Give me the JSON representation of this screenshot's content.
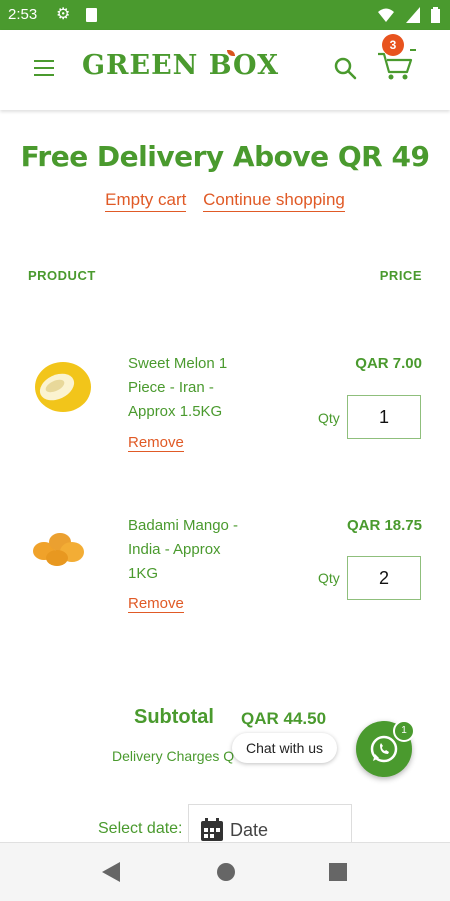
{
  "status": {
    "time": "2:53"
  },
  "header": {
    "brand": "GREEN BOX",
    "cart_count": "3"
  },
  "banner": {
    "title": "Free Delivery Above QR 49"
  },
  "actions": {
    "empty_cart": "Empty cart",
    "continue_shopping": "Continue shopping"
  },
  "columns": {
    "product": "PRODUCT",
    "price": "PRICE"
  },
  "items": [
    {
      "name_line1": "Sweet Melon 1",
      "name_line2": "Piece - Iran -",
      "name_line3": "Approx 1.5KG",
      "remove": "Remove",
      "price": "QAR 7.00",
      "qty_label": "Qty",
      "qty": "1"
    },
    {
      "name_line1": "Badami Mango -",
      "name_line2": "India - Approx",
      "name_line3": "1KG",
      "remove": "Remove",
      "price": "QAR 18.75",
      "qty_label": "Qty",
      "qty": "2"
    }
  ],
  "summary": {
    "subtotal_label": "Subtotal",
    "subtotal_value": "QAR 44.50",
    "delivery_label": "Delivery Charges Q"
  },
  "chat": {
    "label": "Chat with us",
    "badge": "1"
  },
  "date": {
    "label": "Select date:",
    "placeholder": "Date"
  },
  "colors": {
    "brand_green": "#4a9a2e",
    "accent_orange": "#e05a26"
  }
}
